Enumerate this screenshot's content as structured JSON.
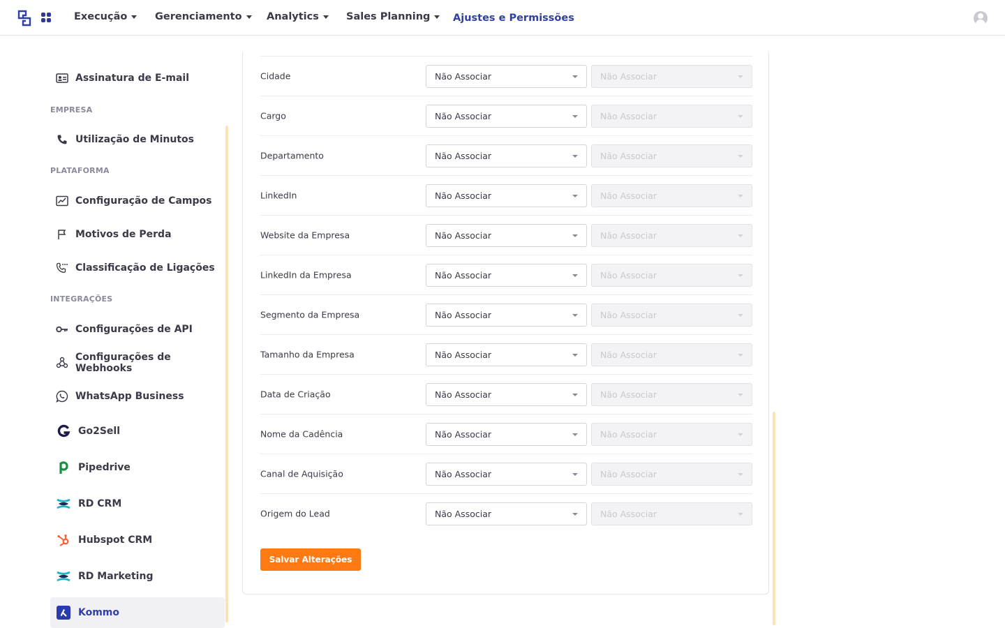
{
  "nav": {
    "items": [
      {
        "label": "Execução"
      },
      {
        "label": "Gerenciamento"
      },
      {
        "label": "Analytics"
      },
      {
        "label": "Sales Planning"
      },
      {
        "label": "Ajustes e Permissões"
      }
    ]
  },
  "sidebar": {
    "email_signature": "Assinatura de E-mail",
    "section_empresa": "EMPRESA",
    "minutes_usage": "Utilização de Minutos",
    "section_plataforma": "PLATAFORMA",
    "fields_config": "Configuração de Campos",
    "loss_reasons": "Motivos de Perda",
    "call_classification": "Classificação de Ligações",
    "section_integracoes": "INTEGRAÇÕES",
    "api_config": "Configurações de API",
    "webhooks_config": "Configurações de Webhooks",
    "whatsapp": "WhatsApp Business",
    "go2sell": "Go2Sell",
    "pipedrive": "Pipedrive",
    "rd_crm": "RD CRM",
    "hubspot": "Hubspot CRM",
    "rd_marketing": "RD Marketing",
    "kommo": "Kommo"
  },
  "mapping": {
    "rows": [
      {
        "label": "Cidade",
        "value": "Não Associar",
        "secondary": "Não Associar"
      },
      {
        "label": "Cargo",
        "value": "Não Associar",
        "secondary": "Não Associar"
      },
      {
        "label": "Departamento",
        "value": "Não Associar",
        "secondary": "Não Associar"
      },
      {
        "label": "LinkedIn",
        "value": "Não Associar",
        "secondary": "Não Associar"
      },
      {
        "label": "Website da Empresa",
        "value": "Não Associar",
        "secondary": "Não Associar"
      },
      {
        "label": "LinkedIn da Empresa",
        "value": "Não Associar",
        "secondary": "Não Associar"
      },
      {
        "label": "Segmento da Empresa",
        "value": "Não Associar",
        "secondary": "Não Associar"
      },
      {
        "label": "Tamanho da Empresa",
        "value": "Não Associar",
        "secondary": "Não Associar"
      },
      {
        "label": "Data de Criação",
        "value": "Não Associar",
        "secondary": "Não Associar"
      },
      {
        "label": "Nome da Cadência",
        "value": "Não Associar",
        "secondary": "Não Associar"
      },
      {
        "label": "Canal de Aquisição",
        "value": "Não Associar",
        "secondary": "Não Associar"
      },
      {
        "label": "Origem do Lead",
        "value": "Não Associar",
        "secondary": "Não Associar"
      }
    ],
    "save_label": "Salvar Alterações"
  },
  "colors": {
    "primary": "#2f3fa6",
    "accent": "#ff7a12",
    "scrollbar": "#fde2b8"
  }
}
